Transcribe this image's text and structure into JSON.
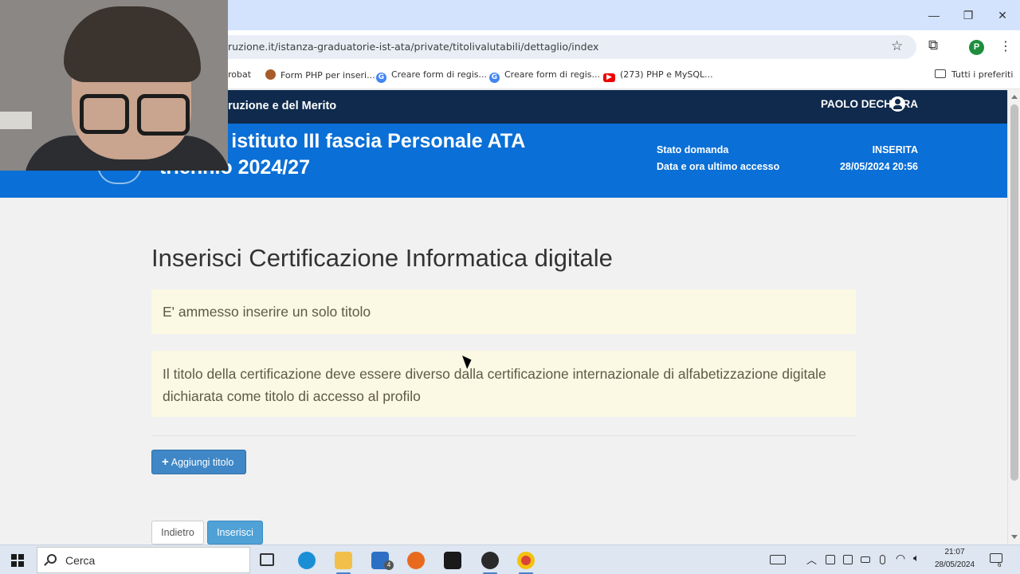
{
  "browser": {
    "url": "ruzione.it/istanza-graduatorie-ist-ata/private/titolivalutabili/dettaglio/index",
    "profile_initial": "P",
    "window_controls": {
      "minimize": "—",
      "restore": "❐",
      "close": "✕"
    },
    "bookmarks": [
      {
        "label": "robat",
        "icon": "none"
      },
      {
        "label": "Form PHP per inseri...",
        "icon": "php-icon"
      },
      {
        "label": "Creare form di regis...",
        "icon": "google-icon"
      },
      {
        "label": "Creare form di regis...",
        "icon": "google-icon"
      },
      {
        "label": "(273) PHP e MySQL...",
        "icon": "youtube-icon"
      }
    ],
    "bookmarks_folder": "Tutti i preferiti"
  },
  "site": {
    "ministry": "ruzione e del Merito",
    "user_name": "PAOLO DECHIARA",
    "banner_title_line1": "torie di istituto III fascia Personale ATA",
    "banner_title_line2": "triennio 2024/27",
    "status_label": "Stato domanda",
    "status_value": "INSERITA",
    "last_access_label": "Data e ora ultimo accesso",
    "last_access_value": "28/05/2024 20:56"
  },
  "main": {
    "title": "Inserisci Certificazione Informatica digitale",
    "alert_1": "E' ammesso inserire un solo titolo",
    "alert_2": "Il titolo della certificazione deve essere diverso dalla certificazione internazionale di alfabetizzazione digitale dichiarata come titolo di accesso al profilo",
    "add_button": "Aggiungi titolo",
    "add_button_icon": "+",
    "back_button": "Indietro",
    "insert_button": "Inserisci"
  },
  "taskbar": {
    "search_placeholder": "Cerca",
    "mail_badge": "4",
    "time": "21:07",
    "date": "28/05/2024",
    "notification_count": "6"
  },
  "colors": {
    "nav_dark": "#0f2a4c",
    "banner_blue": "#0a6fd6",
    "alert_bg": "#fbf8e3",
    "button_blue": "#3f87c6"
  }
}
